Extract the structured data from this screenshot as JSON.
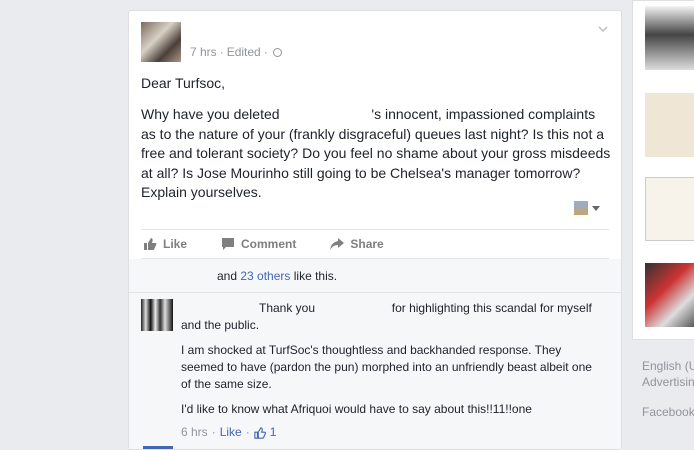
{
  "post": {
    "meta": {
      "time": "7 hrs",
      "sep": "·",
      "edited": "Edited",
      "sep2": "·"
    },
    "greeting": "Dear Turfsoc,",
    "body_before": "Why have you deleted ",
    "body_after": "'s innocent, impassioned complaints as to the nature of your (frankly disgraceful) queues last night? Is this not a free and tolerant society? Do you feel no shame about your gross misdeeds at all? Is Jose Mourinho still going to be Chelsea's manager tomorrow? Explain yourselves.",
    "icons": {
      "menu": "chevron-down-icon",
      "privacy": "globe-icon"
    }
  },
  "actions": {
    "like": "Like",
    "comment": "Comment",
    "share": "Share"
  },
  "likes": {
    "prefix": "and ",
    "others": "23 others",
    "suffix": " like this."
  },
  "comment": {
    "part1": "Thank you",
    "part2": "for highlighting this scandal for myself and the public.",
    "para2": "I am shocked at TurfSoc's thoughtless and backhanded response. They seemed to have (pardon the pun) morphed into an unfriendly beast albeit one of the same size.",
    "para3": "I'd like to know what Afriquoi would have to say about this!!11!!one",
    "time": "6 hrs",
    "sep": "·",
    "like_label": "Like",
    "sep2": "·",
    "like_count": "1"
  },
  "sidebar": {
    "footer": {
      "lang": "English (U",
      "advertising": "Advertisin",
      "facebook": "Facebook"
    }
  },
  "colors": {
    "link": "#4267b2",
    "meta": "#90949c",
    "background": "#e9ebee"
  }
}
